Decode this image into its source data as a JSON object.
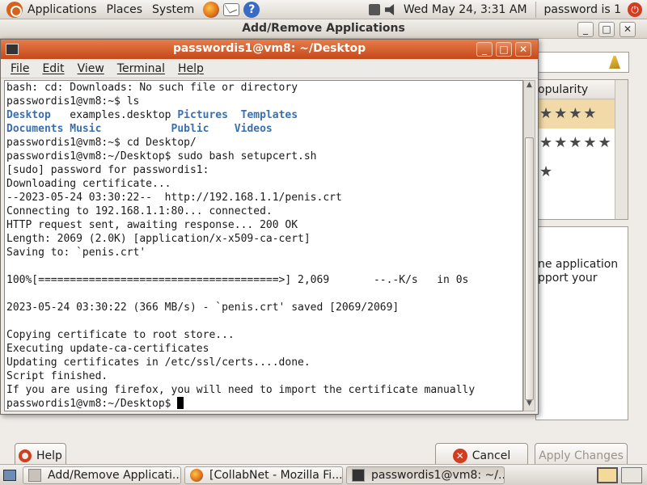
{
  "top_panel": {
    "menus": [
      "Applications",
      "Places",
      "System"
    ],
    "clock": "Wed May 24,  3:31 AM",
    "user": "password is 1"
  },
  "bg_window": {
    "title": "Add/Remove Applications",
    "list_header": "opularity",
    "desc_text": "ne application\npport your",
    "help_label": "Help",
    "cancel_label": "Cancel",
    "apply_label": "Apply Changes",
    "title_buttons": [
      "_",
      "□",
      "✕"
    ]
  },
  "terminal": {
    "title": "passwordis1@vm8: ~/Desktop",
    "menus": [
      "File",
      "Edit",
      "View",
      "Terminal",
      "Help"
    ],
    "lines": [
      "bash: cd: Downloads: No such file or directory",
      "passwordis1@vm8:~$ ls",
      "@@LS1@@",
      "@@LS2@@",
      "passwordis1@vm8:~$ cd Desktop/",
      "passwordis1@vm8:~/Desktop$ sudo bash setupcert.sh",
      "[sudo] password for passwordis1:",
      "Downloading certificate...",
      "--2023-05-24 03:30:22--  http://192.168.1.1/penis.crt",
      "Connecting to 192.168.1.1:80... connected.",
      "HTTP request sent, awaiting response... 200 OK",
      "Length: 2069 (2.0K) [application/x-x509-ca-cert]",
      "Saving to: `penis.crt'",
      "",
      "100%[======================================>] 2,069       --.-K/s   in 0s",
      "",
      "2023-05-24 03:30:22 (366 MB/s) - `penis.crt' saved [2069/2069]",
      "",
      "Copying certificate to root store...",
      "Executing update-ca-certificates",
      "Updating certificates in /etc/ssl/certs....done.",
      "Script finished.",
      "If you are using firefox, you will need to import the certificate manually",
      "passwordis1@vm8:~/Desktop$ "
    ],
    "ls_output": {
      "row1": [
        [
          "Desktop",
          "blue"
        ],
        [
          "examples.desktop",
          "plain"
        ],
        [
          "Pictures",
          "blue"
        ],
        [
          "Templates",
          "blue"
        ]
      ],
      "row2": [
        [
          "Documents",
          "blue"
        ],
        [
          "Music",
          "blue"
        ],
        [
          "Public",
          "blue"
        ],
        [
          "Videos",
          "blue"
        ]
      ]
    },
    "ls_blue_color": "#3a6fb0"
  },
  "taskbar": {
    "tasks": [
      "Add/Remove Applicati...",
      "[CollabNet - Mozilla Fi...",
      "passwordis1@vm8: ~/..."
    ]
  },
  "colors": {
    "terminal_titlebar": "#c5481a",
    "panel": "#dcd6cf"
  }
}
